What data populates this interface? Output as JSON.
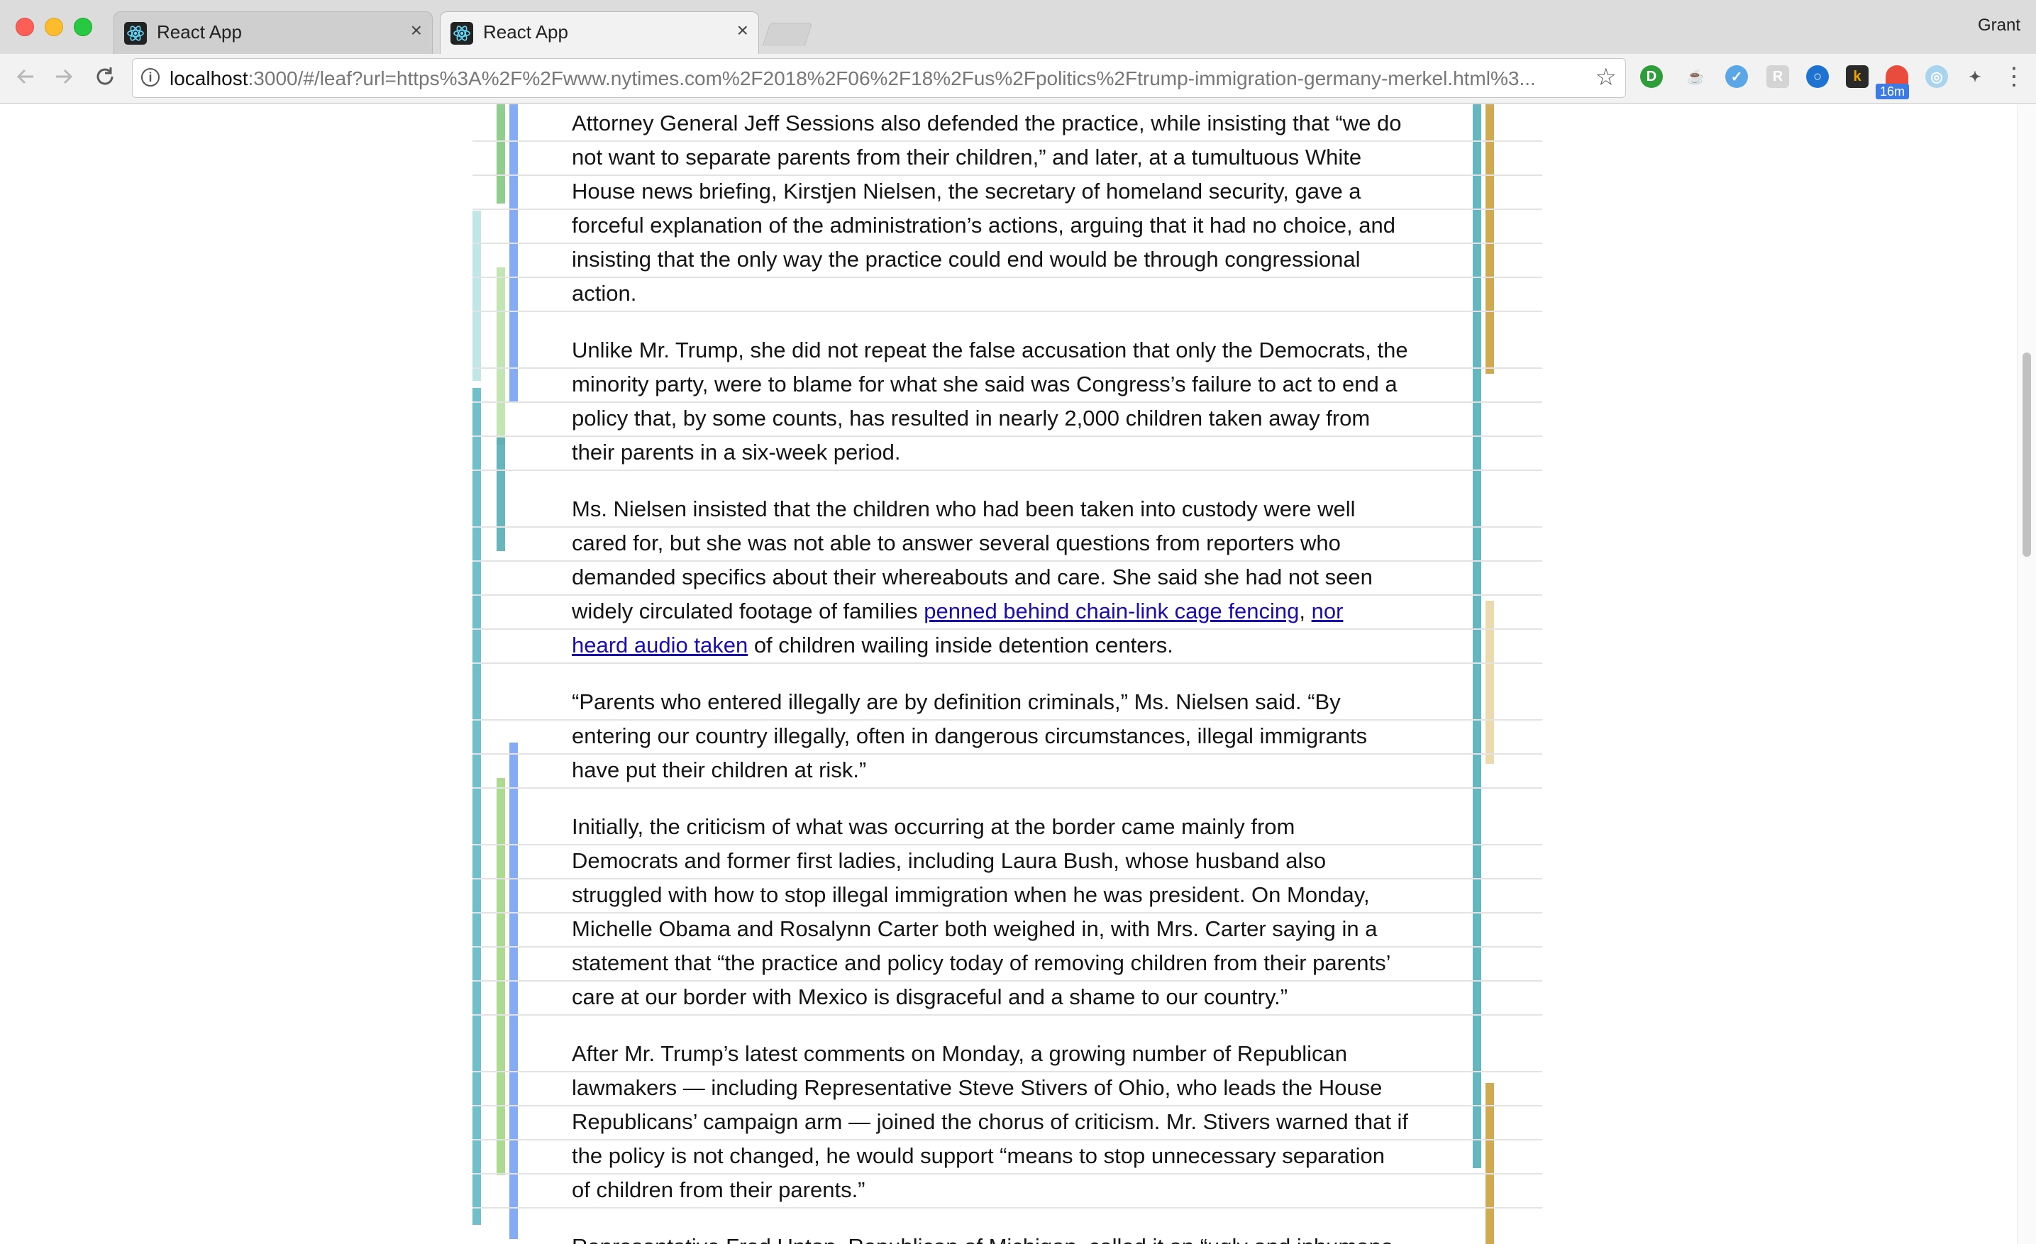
{
  "window": {
    "profile_name": "Grant"
  },
  "tabs": [
    {
      "title": "React App",
      "close": "×",
      "active": false
    },
    {
      "title": "React App",
      "close": "×",
      "active": true
    }
  ],
  "toolbar": {
    "url_host": "localhost",
    "url_rest": ":3000/#/leaf?url=https%3A%2F%2Fwww.nytimes.com%2F2018%2F06%2F18%2Fus%2Fpolitics%2Ftrump-immigration-germany-merkel.html%3...",
    "extension_badge": "16m",
    "icons": [
      "back-arrow-icon",
      "forward-arrow-icon",
      "reload-icon",
      "info-icon",
      "star-icon",
      "menu-dots-icon"
    ]
  },
  "article": {
    "paragraphs": [
      {
        "lines": [
          [
            {
              "text": "Attorney General Jeff Sessions also defended the practice, while insisting that “we do"
            }
          ],
          [
            {
              "text": "not want to separate parents from their children,” and later, at a tumultuous White"
            }
          ],
          [
            {
              "text": "House news briefing, Kirstjen Nielsen, the secretary of homeland security, gave a"
            }
          ],
          [
            {
              "text": "forceful explanation of the administration’s actions, arguing that it had no choice, and"
            }
          ],
          [
            {
              "text": "insisting that the only way the practice could end would be through congressional"
            }
          ],
          [
            {
              "text": "action."
            }
          ]
        ]
      },
      {
        "lines": [
          [
            {
              "text": "Unlike Mr. Trump, she did not repeat the false accusation that only the Democrats, the"
            }
          ],
          [
            {
              "text": "minority party, were to blame for what she said was Congress’s failure to act to end a"
            }
          ],
          [
            {
              "text": "policy that, by some counts, has resulted in nearly 2,000 children taken away from"
            }
          ],
          [
            {
              "text": "their parents in a six-week period."
            }
          ]
        ]
      },
      {
        "lines": [
          [
            {
              "text": "Ms. Nielsen insisted that the children who had been taken into custody were well"
            }
          ],
          [
            {
              "text": "cared for, but she was not able to answer several questions from reporters who"
            }
          ],
          [
            {
              "text": "demanded specifics about their whereabouts and care. She said she had not seen"
            }
          ],
          [
            {
              "text": "widely circulated footage of families "
            },
            {
              "text": "penned behind chain-link cage fencing",
              "link": true
            },
            {
              "text": ", "
            },
            {
              "text": "nor",
              "link": true
            }
          ],
          [
            {
              "text": "heard audio taken",
              "link": true
            },
            {
              "text": " of children wailing inside detention centers."
            }
          ]
        ]
      },
      {
        "lines": [
          [
            {
              "text": "“Parents who entered illegally are by definition criminals,” Ms. Nielsen said. “By"
            }
          ],
          [
            {
              "text": "entering our country illegally, often in dangerous circumstances, illegal immigrants"
            }
          ],
          [
            {
              "text": "have put their children at risk.”"
            }
          ]
        ]
      },
      {
        "lines": [
          [
            {
              "text": "Initially, the criticism of what was occurring at the border came mainly from"
            }
          ],
          [
            {
              "text": "Democrats and former first ladies, including Laura Bush, whose husband also"
            }
          ],
          [
            {
              "text": "struggled with how to stop illegal immigration when he was president. On Monday,"
            }
          ],
          [
            {
              "text": "Michelle Obama and Rosalynn Carter both weighed in, with Mrs. Carter saying in a"
            }
          ],
          [
            {
              "text": "statement that “the practice and policy today of removing children from their parents’"
            }
          ],
          [
            {
              "text": "care at our border with Mexico is disgraceful and a shame to our country.”"
            }
          ]
        ]
      },
      {
        "lines": [
          [
            {
              "text": "After Mr. Trump’s latest comments on Monday, a growing number of Republican"
            }
          ],
          [
            {
              "text": "lawmakers — including Representative Steve Stivers of Ohio, who leads the House"
            }
          ],
          [
            {
              "text": "Republicans’ campaign arm — joined the chorus of criticism. Mr. Stivers warned that if"
            }
          ],
          [
            {
              "text": "the policy is not changed, he would support “means to stop unnecessary separation"
            }
          ],
          [
            {
              "text": "of children from their parents.”"
            }
          ]
        ]
      },
      {
        "lines": [
          [
            {
              "text": "Representative Fred Upton, Republican of Michigan, called it an “ugly and inhumane"
            }
          ]
        ]
      }
    ]
  }
}
